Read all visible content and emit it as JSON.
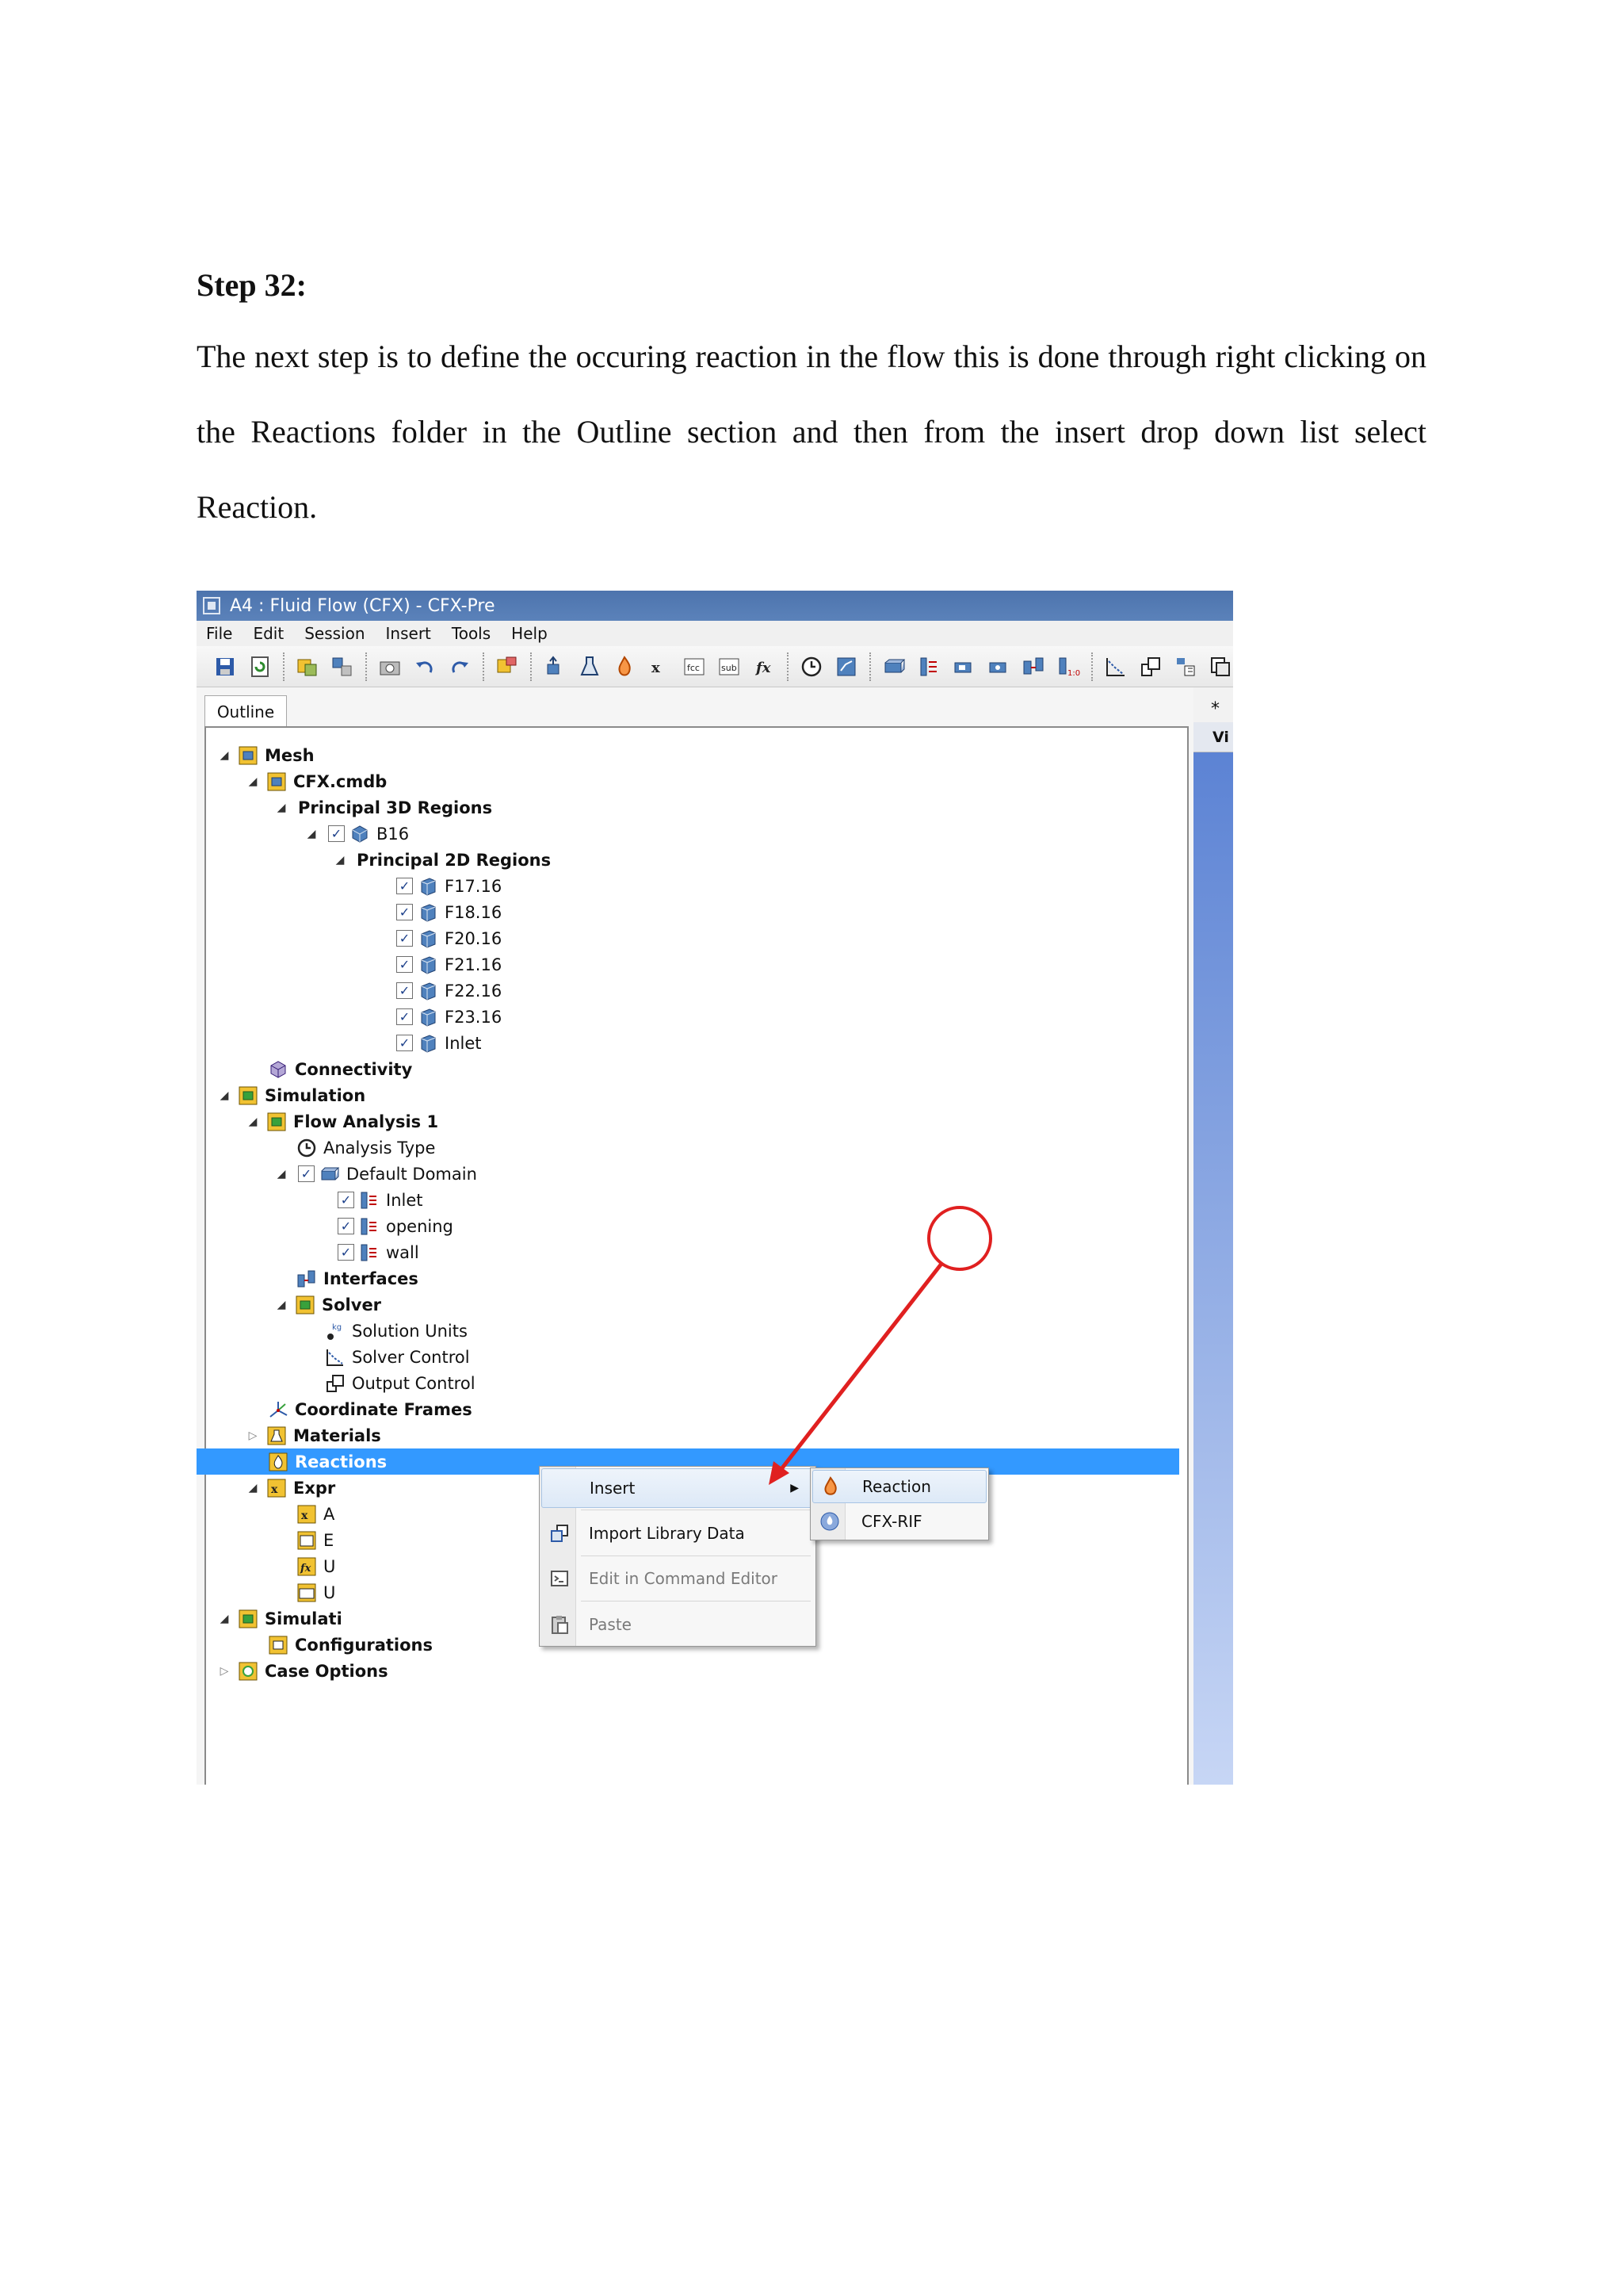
{
  "doc": {
    "heading": "Step 32:",
    "paragraph": "The next step is to define the occuring reaction in the flow this is done through right clicking on the Reactions folder in the Outline section and then from the insert drop down list select Reaction."
  },
  "window": {
    "title": "A4 : Fluid Flow (CFX) - CFX-Pre",
    "menu": [
      "File",
      "Edit",
      "Session",
      "Insert",
      "Tools",
      "Help"
    ]
  },
  "outline": {
    "tab_label": "Outline",
    "right_tab": "Vi",
    "tree": [
      {
        "label": "Mesh",
        "bold": true,
        "icon": "mesh-icon"
      },
      {
        "label": "CFX.cmdb",
        "bold": true,
        "icon": "mesh-file-icon"
      },
      {
        "label": "Principal 3D Regions",
        "bold": true
      },
      {
        "label": "B16",
        "icon": "region-3d-icon"
      },
      {
        "label": "Principal 2D Regions",
        "bold": true
      },
      {
        "label": "F17.16",
        "icon": "region-2d-icon"
      },
      {
        "label": "F18.16",
        "icon": "region-2d-icon"
      },
      {
        "label": "F20.16",
        "icon": "region-2d-icon"
      },
      {
        "label": "F21.16",
        "icon": "region-2d-icon"
      },
      {
        "label": "F22.16",
        "icon": "region-2d-icon"
      },
      {
        "label": "F23.16",
        "icon": "region-2d-icon"
      },
      {
        "label": "Inlet",
        "icon": "region-2d-icon"
      },
      {
        "label": "Connectivity",
        "bold": true,
        "icon": "connectivity-icon"
      },
      {
        "label": "Simulation",
        "bold": true,
        "icon": "simulation-icon"
      },
      {
        "label": "Flow Analysis 1",
        "bold": true,
        "icon": "flow-analysis-icon"
      },
      {
        "label": "Analysis Type",
        "icon": "clock-icon"
      },
      {
        "label": "Default Domain",
        "icon": "domain-icon"
      },
      {
        "label": "Inlet",
        "icon": "boundary-icon"
      },
      {
        "label": "opening",
        "icon": "boundary-icon"
      },
      {
        "label": "wall",
        "icon": "boundary-icon"
      },
      {
        "label": "Interfaces",
        "bold": true,
        "icon": "interfaces-icon"
      },
      {
        "label": "Solver",
        "bold": true,
        "icon": "solver-icon"
      },
      {
        "label": "Solution Units",
        "icon": "solution-units-icon"
      },
      {
        "label": "Solver Control",
        "icon": "solver-control-icon"
      },
      {
        "label": "Output Control",
        "icon": "output-control-icon"
      },
      {
        "label": "Coordinate Frames",
        "bold": true,
        "icon": "coordinate-frames-icon"
      },
      {
        "label": "Materials",
        "bold": true,
        "icon": "materials-icon"
      },
      {
        "label": "Reactions",
        "bold": true,
        "icon": "reactions-icon"
      },
      {
        "label": "Expr",
        "bold": true,
        "icon": "expressions-icon"
      },
      {
        "label": "A",
        "icon": "expression-icon"
      },
      {
        "label": "E",
        "icon": "fcc-icon"
      },
      {
        "label": "U",
        "icon": "function-icon"
      },
      {
        "label": "U",
        "icon": "sub-icon"
      },
      {
        "label": "Simulati",
        "bold": true,
        "icon": "simulation-control-icon"
      },
      {
        "label": "Configurations",
        "bold": true,
        "icon": "configurations-icon"
      },
      {
        "label": "Case Options",
        "bold": true,
        "icon": "case-options-icon"
      }
    ]
  },
  "context_menu": {
    "items": [
      "Insert",
      "Import Library Data",
      "Edit in Command Editor",
      "Paste"
    ],
    "submenu": [
      "Reaction",
      "CFX-RIF"
    ]
  },
  "colors": {
    "selection": "#3399ff",
    "annotation": "#e02020",
    "title_bar": "#5b82ba"
  }
}
